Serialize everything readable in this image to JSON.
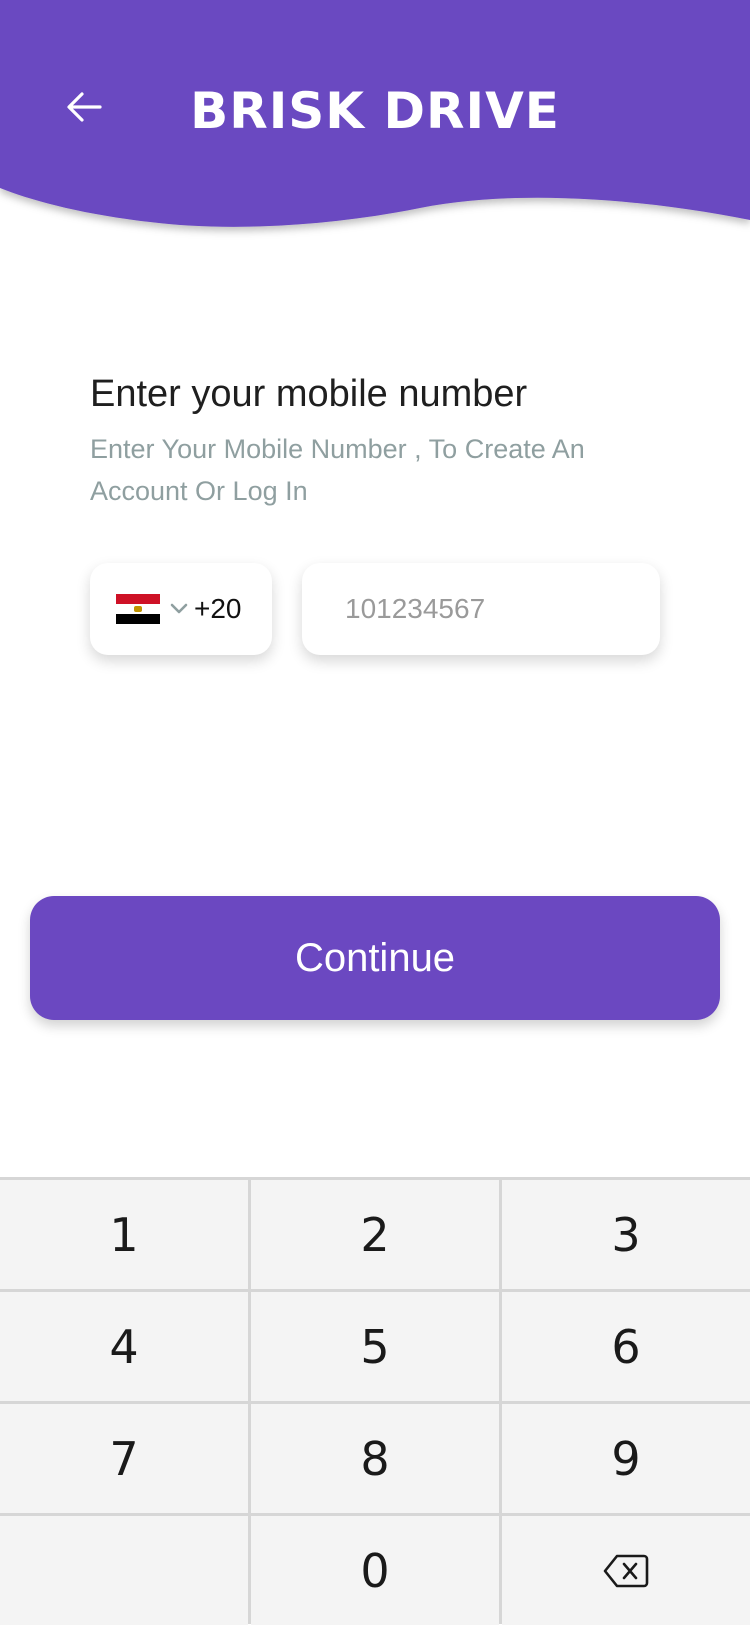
{
  "header": {
    "brand": "BRISK DRIVE",
    "back_icon": "arrow-left-icon",
    "color": "#6b48c1"
  },
  "form": {
    "title": "Enter your mobile number",
    "subtitle": "Enter Your Mobile Number , To Create An Account Or Log In",
    "country": {
      "flag_icon": "egypt-flag-icon",
      "dial_code": "+20"
    },
    "phone": {
      "placeholder": "101234567",
      "value": ""
    }
  },
  "continue_label": "Continue",
  "keypad": {
    "keys": [
      "1",
      "2",
      "3",
      "4",
      "5",
      "6",
      "7",
      "8",
      "9",
      "",
      "0"
    ],
    "backspace_icon": "backspace-icon"
  }
}
